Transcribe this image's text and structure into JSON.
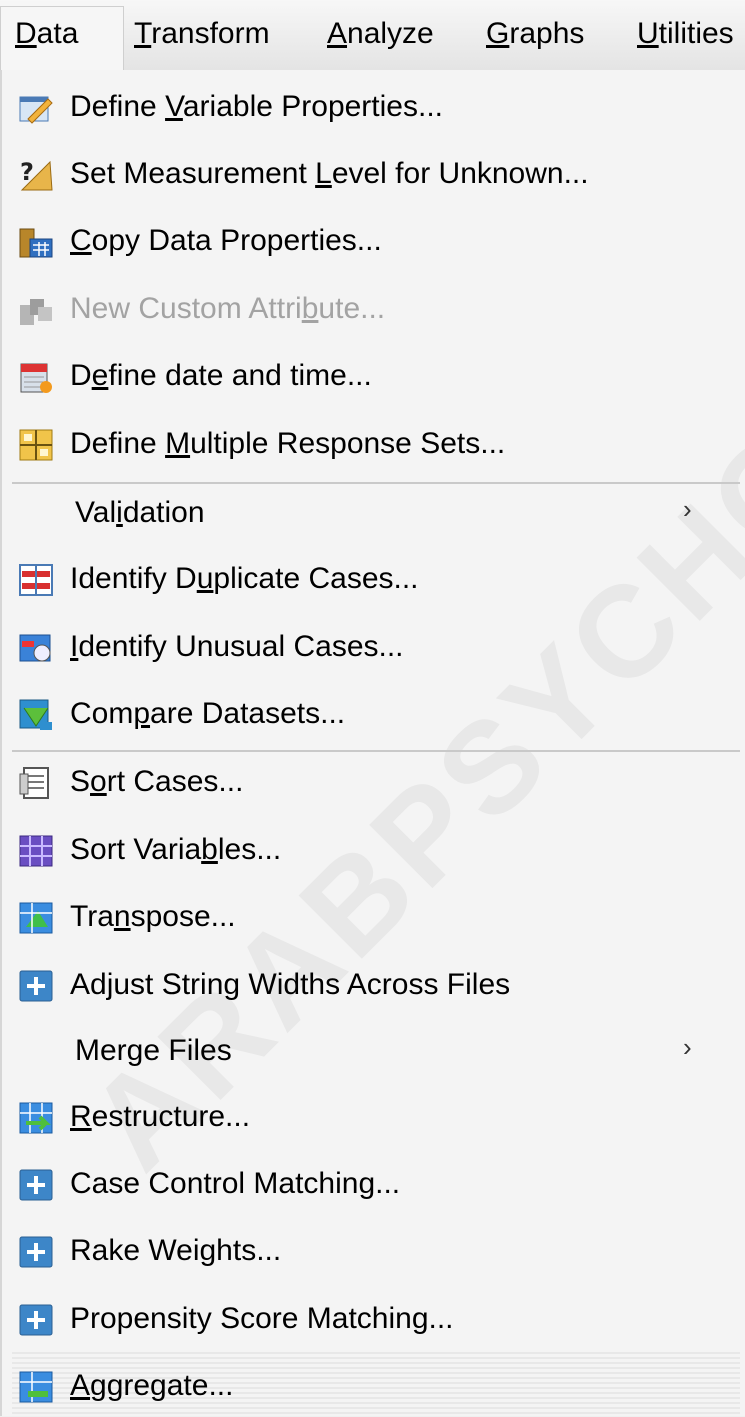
{
  "menubar": {
    "items": [
      "Data",
      "Transform",
      "Analyze",
      "Graphs",
      "Utilities"
    ],
    "mnemonics": [
      "D",
      "T",
      "A",
      "G",
      "U"
    ]
  },
  "menu": {
    "items": [
      {
        "pre": "Define ",
        "u": "V",
        "post": "ariable Properties...",
        "icon": "define-variable-properties-icon"
      },
      {
        "pre": "Set Measurement ",
        "u": "L",
        "post": "evel for Unknown...",
        "icon": "question-ruler-icon"
      },
      {
        "pre": "",
        "u": "C",
        "post": "opy Data Properties...",
        "icon": "copy-data-properties-icon"
      },
      {
        "pre": "New Custom Attri",
        "u": "b",
        "post": "ute...",
        "icon": "custom-attribute-icon",
        "disabled": true
      },
      {
        "pre": "D",
        "u": "e",
        "post": "fine date and time...",
        "icon": "calendar-icon"
      },
      {
        "pre": "Define ",
        "u": "M",
        "post": "ultiple Response Sets...",
        "icon": "grid-icon"
      },
      {
        "pre": "Val",
        "u": "i",
        "post": "dation",
        "submenu": true
      },
      {
        "pre": "Identify D",
        "u": "u",
        "post": "plicate Cases...",
        "icon": "duplicate-cases-icon"
      },
      {
        "pre": "",
        "u": "I",
        "post": "dentify Unusual Cases...",
        "icon": "unusual-cases-icon"
      },
      {
        "pre": "Com",
        "u": "p",
        "post": "are Datasets...",
        "icon": "compare-datasets-icon"
      },
      {
        "pre": "S",
        "u": "o",
        "post": "rt Cases...",
        "icon": "sort-cases-icon"
      },
      {
        "pre": "Sort Varia",
        "u": "b",
        "post": "les...",
        "icon": "sort-variables-icon"
      },
      {
        "pre": "Tra",
        "u": "n",
        "post": "spose...",
        "icon": "transpose-icon"
      },
      {
        "pre": "Adjust String Widths Across Files",
        "u": "",
        "post": "",
        "icon": "plus-icon"
      },
      {
        "pre": "Merge Files",
        "u": "",
        "post": "",
        "submenu": true
      },
      {
        "pre": "",
        "u": "R",
        "post": "estructure...",
        "icon": "restructure-icon"
      },
      {
        "pre": "Case Control Matching...",
        "u": "",
        "post": "",
        "icon": "plus-icon"
      },
      {
        "pre": "Rake Weights...",
        "u": "",
        "post": "",
        "icon": "plus-icon"
      },
      {
        "pre": "Propensity Score Matching...",
        "u": "",
        "post": "",
        "icon": "plus-icon"
      },
      {
        "pre": "",
        "u": "A",
        "post": "ggregate...",
        "icon": "aggregate-icon"
      }
    ],
    "submenu_arrow": "›"
  },
  "watermark": "ARABPSYCHOL"
}
